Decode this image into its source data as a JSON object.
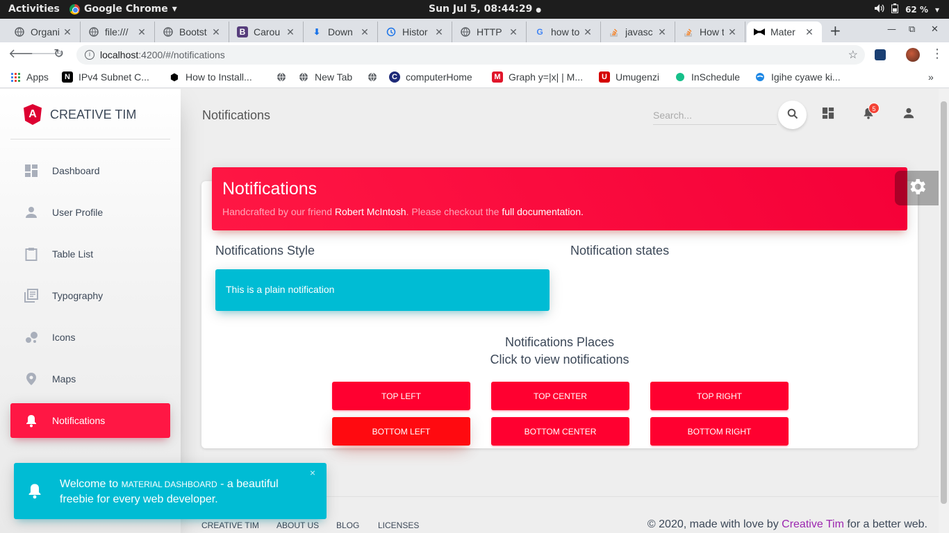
{
  "gnome": {
    "activities": "Activities",
    "app_name": "Google Chrome",
    "app_caret": "▾",
    "clock": "Sun Jul  5, 08:44:29",
    "battery": "62 %"
  },
  "tabs": [
    {
      "title": "Organi",
      "icon": "globe-icon"
    },
    {
      "title": "file:///",
      "icon": "globe-icon"
    },
    {
      "title": "Bootst",
      "icon": "globe-icon"
    },
    {
      "title": "Carou",
      "icon": "bootstrap-icon"
    },
    {
      "title": "Down",
      "icon": "download-icon"
    },
    {
      "title": "Histor",
      "icon": "history-icon"
    },
    {
      "title": "HTTP",
      "icon": "globe-icon"
    },
    {
      "title": "how to",
      "icon": "google-icon"
    },
    {
      "title": "javasc",
      "icon": "stackoverflow-icon"
    },
    {
      "title": "How t",
      "icon": "stackoverflow-icon"
    },
    {
      "title": "Mater",
      "icon": "bowtie-icon"
    }
  ],
  "address": {
    "host": "localhost",
    "rest": ":4200/#/notifications"
  },
  "bookmarks": [
    {
      "label": "Apps",
      "icon": "apps-icon"
    },
    {
      "label": "IPv4 Subnet C...",
      "icon": "notion-icon"
    },
    {
      "label": "How to Install...",
      "icon": "hexagon-icon"
    },
    {
      "label": "",
      "icon": "globe-icon"
    },
    {
      "label": "New Tab",
      "icon": "globe-icon"
    },
    {
      "label": "",
      "icon": "globe-icon"
    },
    {
      "label": "computerHome",
      "icon": "computer-icon"
    },
    {
      "label": "Graph y=|x| | M...",
      "icon": "math-icon"
    },
    {
      "label": "Umugenzi",
      "icon": "umugenzi-icon"
    },
    {
      "label": "InSchedule",
      "icon": "inschedule-icon"
    },
    {
      "label": "Igihe cyawe ki...",
      "icon": "igihe-icon"
    }
  ],
  "sidebar": {
    "brand": "CREATIVE TIM",
    "brand_logo_letter": "A",
    "items": [
      {
        "label": "Dashboard",
        "icon": "dashboard-icon"
      },
      {
        "label": "User Profile",
        "icon": "person-icon"
      },
      {
        "label": "Table List",
        "icon": "clipboard-icon"
      },
      {
        "label": "Typography",
        "icon": "library-books-icon"
      },
      {
        "label": "Icons",
        "icon": "bubble-chart-icon"
      },
      {
        "label": "Maps",
        "icon": "location-pin-icon"
      },
      {
        "label": "Notifications",
        "icon": "bell-icon",
        "active": true
      }
    ]
  },
  "navbar": {
    "title": "Notifications",
    "search_placeholder": "Search...",
    "notification_count": "5"
  },
  "card": {
    "title": "Notifications",
    "sub_prefix": "Handcrafted by our friend ",
    "sub_author": "Robert McIntosh",
    "sub_middle": ". Please checkout the ",
    "sub_link": "full documentation.",
    "style_title": "Notifications Style",
    "states_title": "Notification states",
    "plain_notification": "This is a plain notification",
    "places_title": "Notifications Places",
    "places_subtitle": "Click to view notifications",
    "buttons": {
      "top_left": "Top Left",
      "top_center": "Top Center",
      "top_right": "Top Right",
      "bottom_left": "Bottom Left",
      "bottom_center": "Bottom Center",
      "bottom_right": "Bottom Right"
    }
  },
  "footer": {
    "links": [
      "Creative Tim",
      "About Us",
      "Blog",
      "Licenses"
    ],
    "copyright_prefix": "© 2020, made with love by ",
    "copyright_link": "Creative Tim",
    "copyright_suffix": " for a better web."
  },
  "toast": {
    "prefix": "Welcome to ",
    "brand": "MATERIAL DASHBOARD",
    "suffix": " - a beautiful freebie for every web developer.",
    "close": "×"
  },
  "colors": {
    "accent": "#ff1744",
    "info": "#00bcd4",
    "link": "#9c27b0"
  }
}
